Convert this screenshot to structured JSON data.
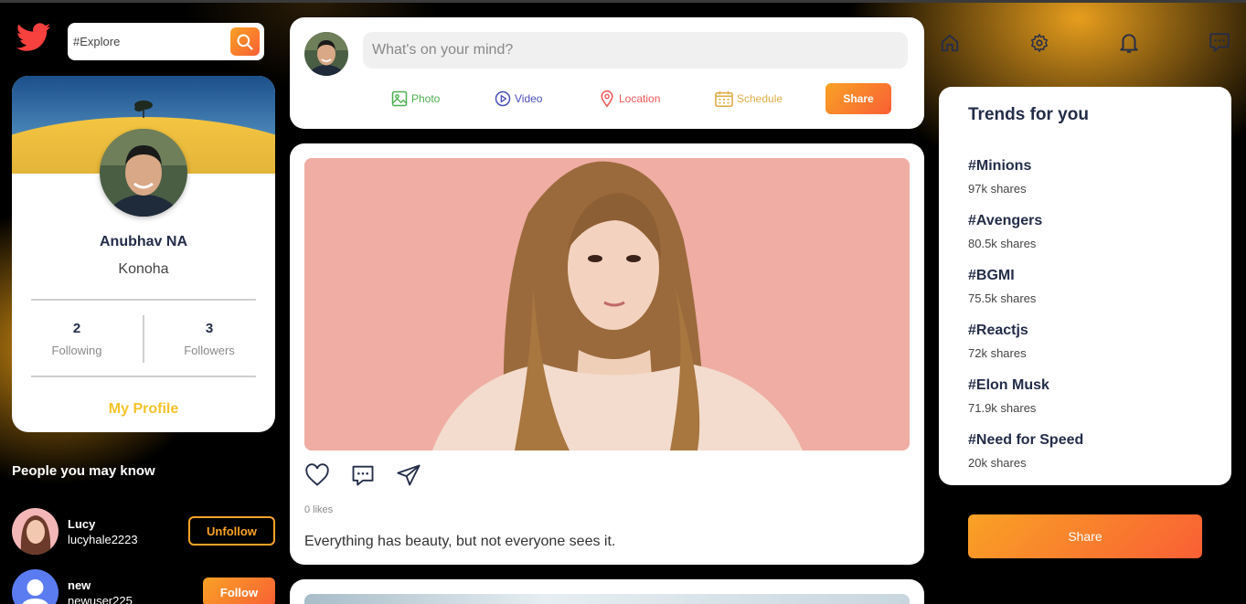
{
  "search": {
    "placeholder": "#Explore"
  },
  "profile": {
    "name": "Anubhav NA",
    "location": "Konoha",
    "following_count": "2",
    "following_label": "Following",
    "followers_count": "3",
    "followers_label": "Followers",
    "my_profile_label": "My Profile"
  },
  "people": {
    "title": "People you may know",
    "items": [
      {
        "name": "Lucy",
        "username": "lucyhale2223",
        "action": "Unfollow"
      },
      {
        "name": "new",
        "username": "newuser225",
        "action": "Follow"
      }
    ]
  },
  "composer": {
    "placeholder": "What's on your mind?",
    "options": [
      {
        "label": "Photo",
        "icon": "image-icon",
        "color": "#4caf50"
      },
      {
        "label": "Video",
        "icon": "play-circle-icon",
        "color": "#4a4eb7"
      },
      {
        "label": "Location",
        "icon": "map-pin-icon",
        "color": "#ef5757"
      },
      {
        "label": "Schedule",
        "icon": "calendar-icon",
        "color": "#e1ae4a"
      }
    ],
    "share_label": "Share"
  },
  "post": {
    "likes": "0 likes",
    "caption": "Everything has beauty, but not everyone sees it."
  },
  "nav": {
    "icons": [
      "home-icon",
      "gear-icon",
      "bell-icon",
      "comment-icon"
    ]
  },
  "trends": {
    "title": "Trends for you",
    "items": [
      {
        "tag": "#Minions",
        "shares": "97k shares"
      },
      {
        "tag": "#Avengers",
        "shares": "80.5k shares"
      },
      {
        "tag": "#BGMI",
        "shares": "75.5k shares"
      },
      {
        "tag": "#Reactjs",
        "shares": "72k shares"
      },
      {
        "tag": "#Elon Musk",
        "shares": "71.9k shares"
      },
      {
        "tag": "#Need for Speed",
        "shares": "20k shares"
      }
    ]
  },
  "right_share_label": "Share",
  "colors": {
    "accent": "#f9a225",
    "accent2": "#f95f35",
    "yellow": "#f5c32c",
    "text": "#242d49"
  }
}
